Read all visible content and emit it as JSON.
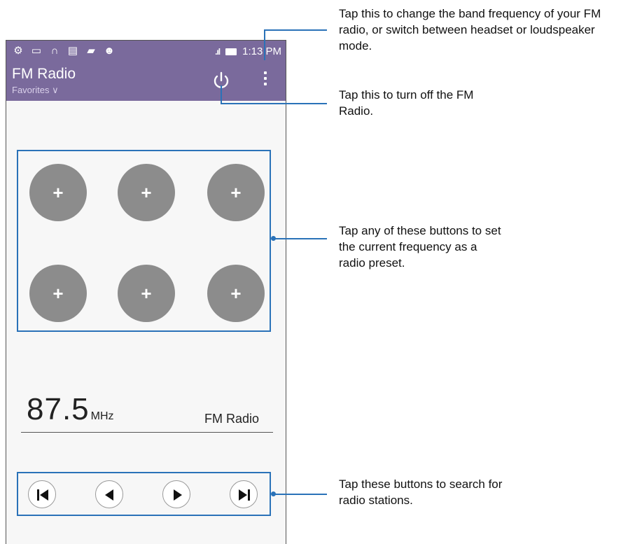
{
  "status_bar": {
    "time": "1:13 PM",
    "left_icons": [
      "settings-icon",
      "image-icon",
      "headset-icon",
      "cpu-icon",
      "sd-card-icon",
      "android-icon"
    ],
    "signal": ".ıl"
  },
  "action_bar": {
    "title": "FM Radio",
    "subtitle": "Favorites",
    "subtitle_chevron": "∨",
    "background": "#7a6a9c"
  },
  "presets": [
    {
      "label": "+"
    },
    {
      "label": "+"
    },
    {
      "label": "+"
    },
    {
      "label": "+"
    },
    {
      "label": "+"
    },
    {
      "label": "+"
    }
  ],
  "tuner": {
    "frequency": "87.5",
    "unit": "MHz",
    "station": "FM Radio"
  },
  "controls": [
    {
      "name": "skip-previous"
    },
    {
      "name": "seek-previous"
    },
    {
      "name": "seek-next"
    },
    {
      "name": "skip-next"
    }
  ],
  "callouts": {
    "menu": "Tap this to change the band frequency of your FM radio, or switch between headset or loudspeaker mode.",
    "power": "Tap this to turn off the FM Radio.",
    "presets": "Tap any of these buttons to set the current frequency as a radio preset.",
    "controls": "Tap these buttons to search for radio stations."
  },
  "accent_color": "#2a72b8"
}
